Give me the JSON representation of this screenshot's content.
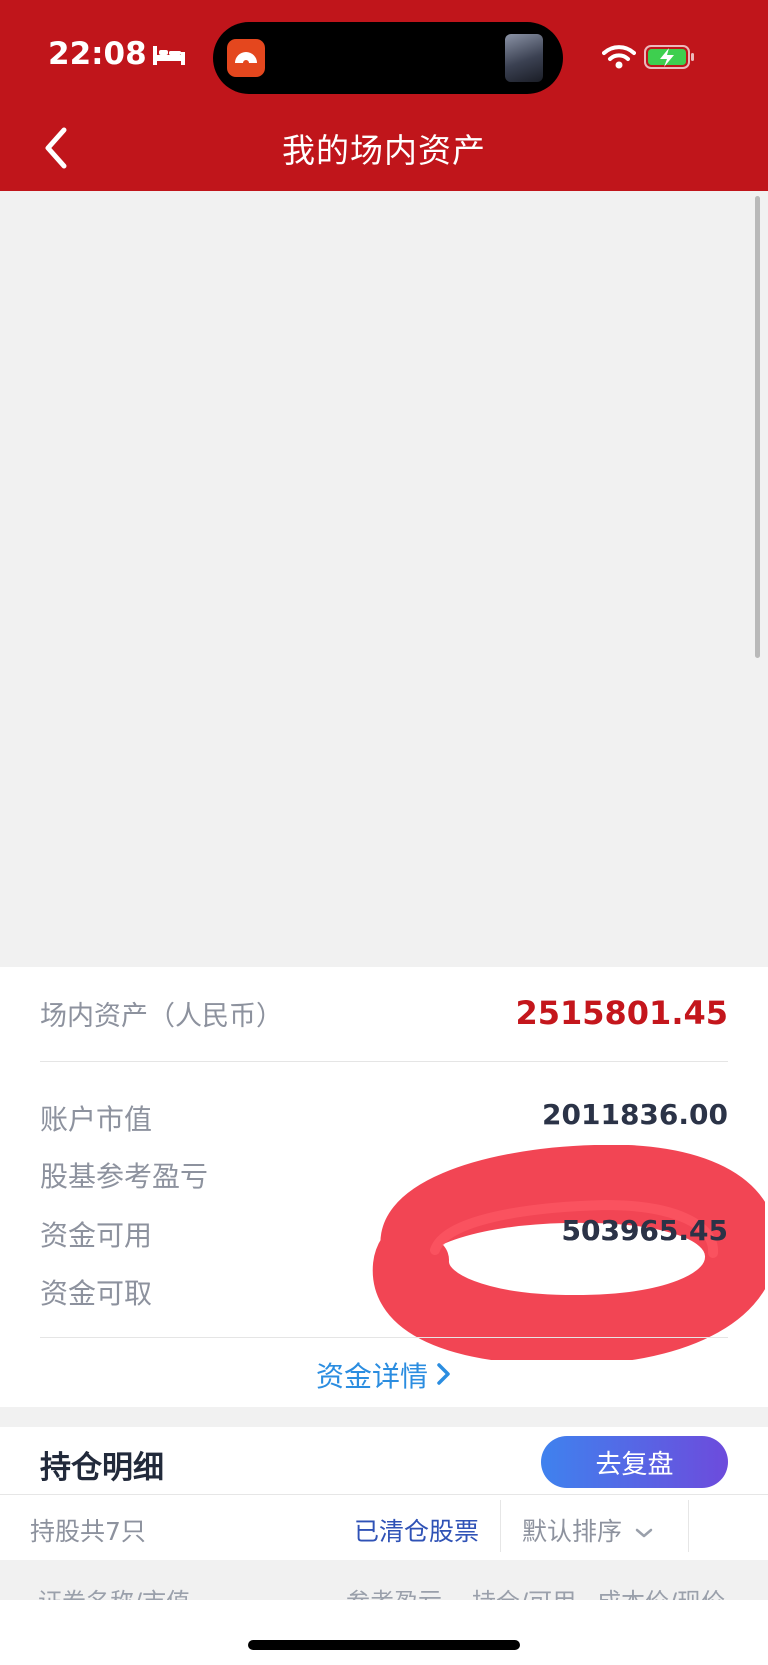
{
  "status_bar": {
    "time": "22:08",
    "icons": [
      "bed-icon",
      "app-icon",
      "media-thumbnail",
      "wifi-icon",
      "battery-charging-icon"
    ]
  },
  "header": {
    "title": "我的场内资产",
    "back_icon": "chevron-left-icon",
    "background_color": "#c0151b"
  },
  "assets": {
    "total_label": "场内资产（人民币）",
    "total_value": "2515801.45",
    "rows": [
      {
        "label": "账户市值",
        "value": "2011836.00"
      },
      {
        "label": "股基参考盈亏",
        "value": ""
      },
      {
        "label": "资金可用",
        "value": "503965.45"
      },
      {
        "label": "资金可取",
        "value": ""
      }
    ],
    "detail_link": "资金详情"
  },
  "holdings": {
    "title": "持仓明细",
    "review_button": "去复盘",
    "stock_count": "持股共7只",
    "cleared_link": "已清仓股票",
    "sort_label": "默认排序",
    "columns": [
      "证券名称/市值",
      "参考盈亏",
      "持仓/可用",
      "成本价/现价"
    ]
  },
  "colors": {
    "accent_red": "#c4161c",
    "link_blue": "#2b8de0",
    "button_gradient_start": "#3f82ee",
    "button_gradient_end": "#6d4bdc"
  }
}
